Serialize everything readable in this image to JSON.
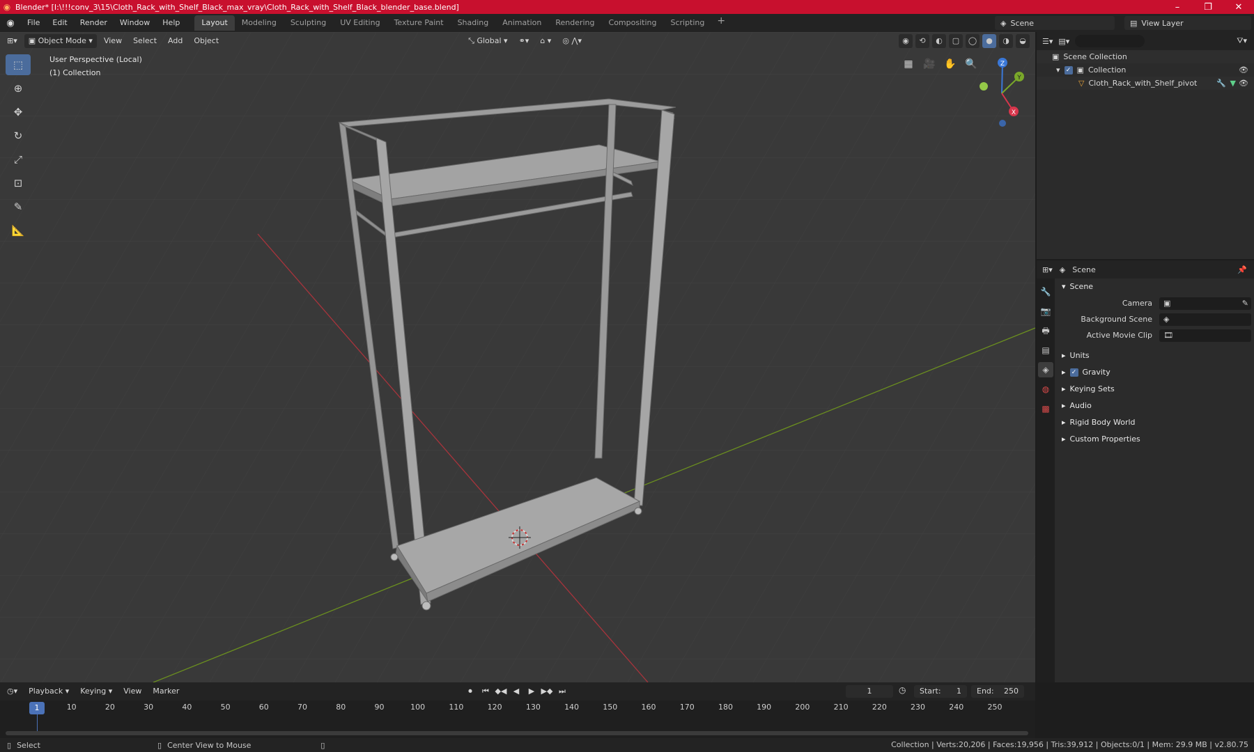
{
  "window": {
    "title": "Blender* [I:\\!!!conv_3\\15\\Cloth_Rack_with_Shelf_Black_max_vray\\Cloth_Rack_with_Shelf_Black_blender_base.blend]",
    "minimize": "–",
    "maximize": "❐",
    "close": "✕"
  },
  "menu": [
    "File",
    "Edit",
    "Render",
    "Window",
    "Help"
  ],
  "workspaces": [
    "Layout",
    "Modeling",
    "Sculpting",
    "UV Editing",
    "Texture Paint",
    "Shading",
    "Animation",
    "Rendering",
    "Compositing",
    "Scripting"
  ],
  "workspace_add": "+",
  "scene_selector": "Scene",
  "view_layer_selector": "View Layer",
  "viewport": {
    "mode": "Object Mode",
    "menus": [
      "View",
      "Select",
      "Add",
      "Object"
    ],
    "orientation": "Global",
    "info_line1": "User Perspective (Local)",
    "info_line2": "(1) Collection",
    "gizmo": {
      "x": "X",
      "y": "Y",
      "z": "Z"
    }
  },
  "outliner": {
    "search_placeholder": "",
    "scene_collection": "Scene Collection",
    "collection": "Collection",
    "object": "Cloth_Rack_with_Shelf_pivot"
  },
  "properties": {
    "context": "Scene",
    "panel": "Scene",
    "fields": [
      {
        "label": "Camera",
        "value": ""
      },
      {
        "label": "Background Scene",
        "value": ""
      },
      {
        "label": "Active Movie Clip",
        "value": ""
      }
    ],
    "sections": [
      "Units",
      "Gravity",
      "Keying Sets",
      "Audio",
      "Rigid Body World",
      "Custom Properties"
    ],
    "gravity_checked": true
  },
  "timeline": {
    "menus": [
      "Playback",
      "Keying",
      "View",
      "Marker"
    ],
    "current_frame": "1",
    "start_label": "Start:",
    "start": "1",
    "end_label": "End:",
    "end": "250",
    "ticks": [
      "1",
      "10",
      "20",
      "30",
      "40",
      "50",
      "60",
      "70",
      "80",
      "90",
      "100",
      "110",
      "120",
      "130",
      "140",
      "150",
      "160",
      "170",
      "180",
      "190",
      "200",
      "210",
      "220",
      "230",
      "240",
      "250"
    ]
  },
  "status": {
    "left1": "Select",
    "left2": "Center View to Mouse",
    "right": "Collection | Verts:20,206 | Faces:19,956 | Tris:39,912 | Objects:0/1 | Mem: 29.9 MB | v2.80.75"
  },
  "colors": {
    "accent": "#4b6c9c",
    "title_bar": "#c8102e",
    "viewport_bg": "#393939",
    "axis_x": "#a8343c",
    "axis_y": "#6b8f1f"
  }
}
